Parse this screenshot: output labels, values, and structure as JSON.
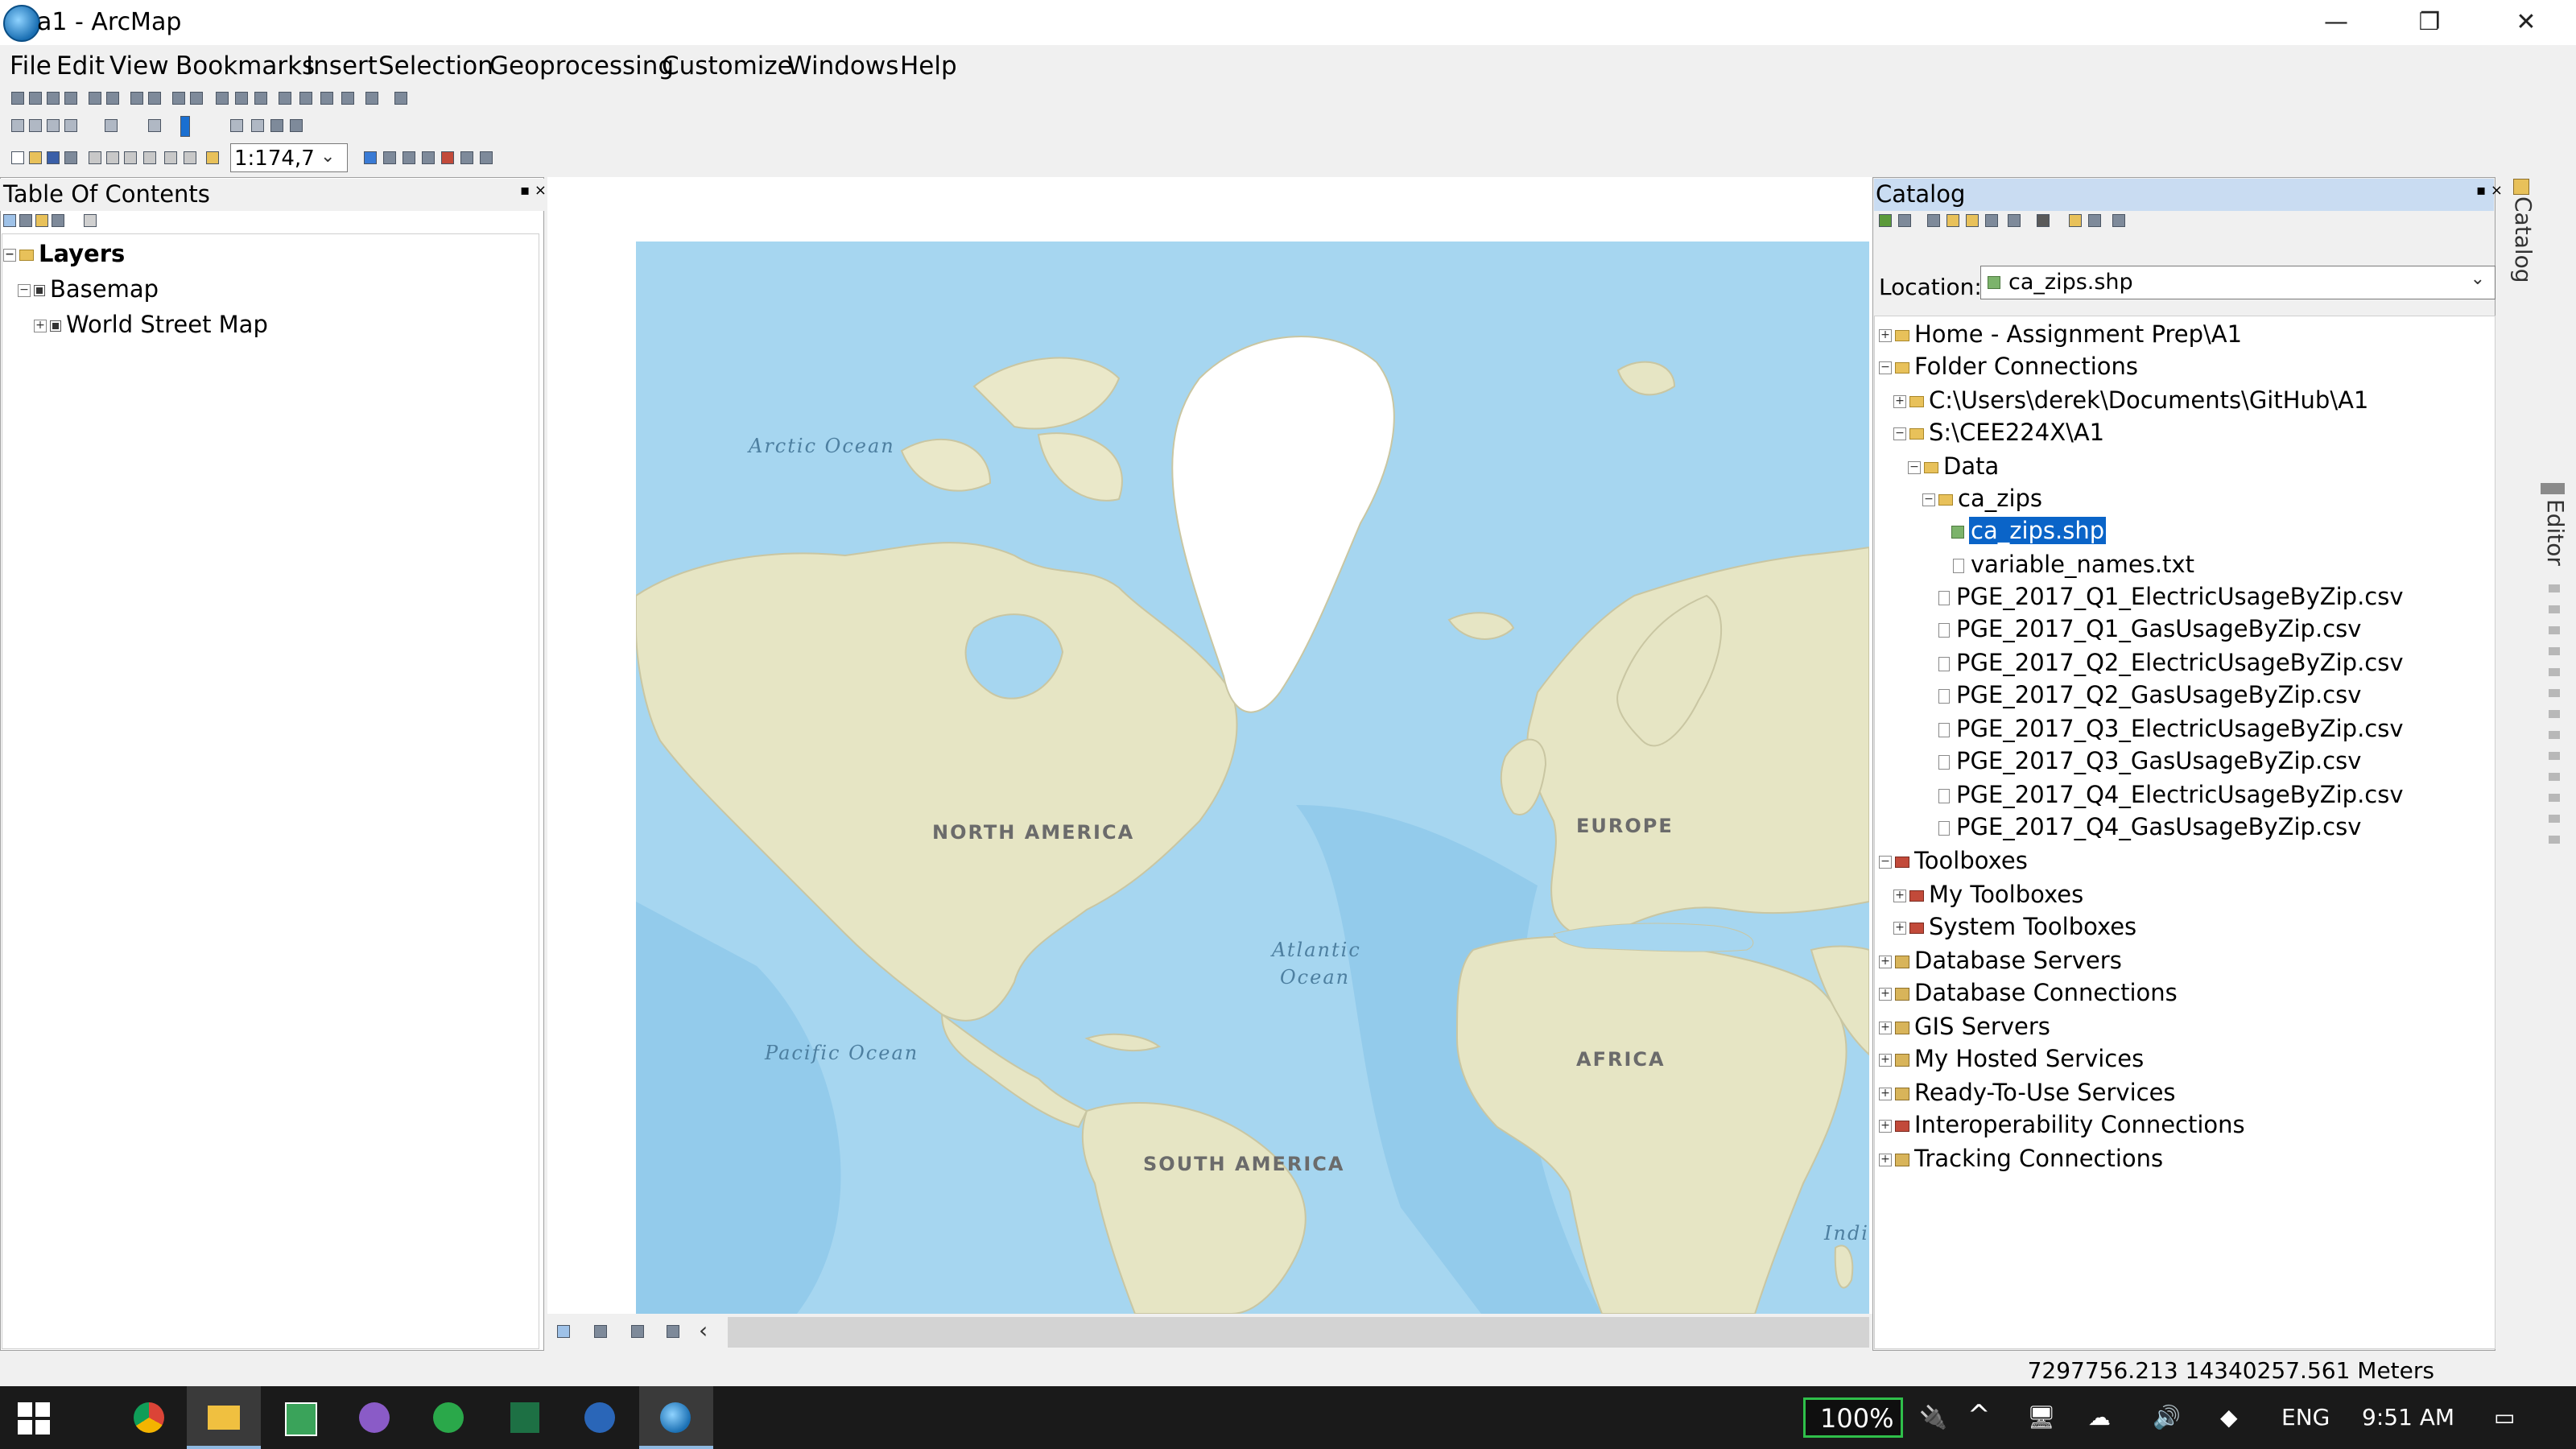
{
  "window": {
    "title": "a1 - ArcMap",
    "minimize": "—",
    "restore": "❐",
    "close": "✕"
  },
  "menu": [
    "File",
    "Edit",
    "View",
    "Bookmarks",
    "Insert",
    "Selection",
    "Geoprocessing",
    "Customize",
    "Windows",
    "Help"
  ],
  "toolbar": {
    "scale_value": "1:174,7"
  },
  "toc": {
    "title": "Table Of Contents",
    "pin": "▪ ×",
    "items": [
      {
        "label": "Layers"
      },
      {
        "label": "Basemap"
      },
      {
        "label": "World Street Map"
      }
    ]
  },
  "map": {
    "labels": {
      "arctic": "Arctic Ocean",
      "north_america": "NORTH AMERICA",
      "europe": "EUROPE",
      "atlantic_1": "Atlantic",
      "atlantic_2": "Ocean",
      "pacific": "Pacific Ocean",
      "africa": "AFRICA",
      "south_america": "SOUTH AMERICA",
      "india": "India"
    },
    "colors": {
      "ocean": "#a6d6f0",
      "deep_ocean": "#8fc7e8",
      "land": "#eae8c9",
      "ice": "#ffffff"
    }
  },
  "catalog": {
    "title": "Catalog",
    "pin": "▪ ×",
    "location_label": "Location:",
    "location_value": "ca_zips.shp",
    "tree": [
      {
        "label": "Home - Assignment Prep\\A1"
      },
      {
        "label": "Folder Connections"
      },
      {
        "label": "C:\\Users\\derek\\Documents\\GitHub\\A1"
      },
      {
        "label": "S:\\CEE224X\\A1"
      },
      {
        "label": "Data"
      },
      {
        "label": "ca_zips"
      },
      {
        "label": "ca_zips.shp"
      },
      {
        "label": "variable_names.txt"
      },
      {
        "label": "PGE_2017_Q1_ElectricUsageByZip.csv"
      },
      {
        "label": "PGE_2017_Q1_GasUsageByZip.csv"
      },
      {
        "label": "PGE_2017_Q2_ElectricUsageByZip.csv"
      },
      {
        "label": "PGE_2017_Q2_GasUsageByZip.csv"
      },
      {
        "label": "PGE_2017_Q3_ElectricUsageByZip.csv"
      },
      {
        "label": "PGE_2017_Q3_GasUsageByZip.csv"
      },
      {
        "label": "PGE_2017_Q4_ElectricUsageByZip.csv"
      },
      {
        "label": "PGE_2017_Q4_GasUsageByZip.csv"
      },
      {
        "label": "Toolboxes"
      },
      {
        "label": "My Toolboxes"
      },
      {
        "label": "System Toolboxes"
      },
      {
        "label": "Database Servers"
      },
      {
        "label": "Database Connections"
      },
      {
        "label": "GIS Servers"
      },
      {
        "label": "My Hosted Services"
      },
      {
        "label": "Ready-To-Use Services"
      },
      {
        "label": "Interoperability Connections"
      },
      {
        "label": "Tracking Connections"
      }
    ]
  },
  "right_dock": {
    "catalog_tab": "Catalog",
    "editor_tab": "Editor"
  },
  "status": {
    "coordinates": "7297756.213  14340257.561 Meters"
  },
  "taskbar": {
    "battery": "100%",
    "language": "ENG",
    "time": "9:51 AM"
  }
}
